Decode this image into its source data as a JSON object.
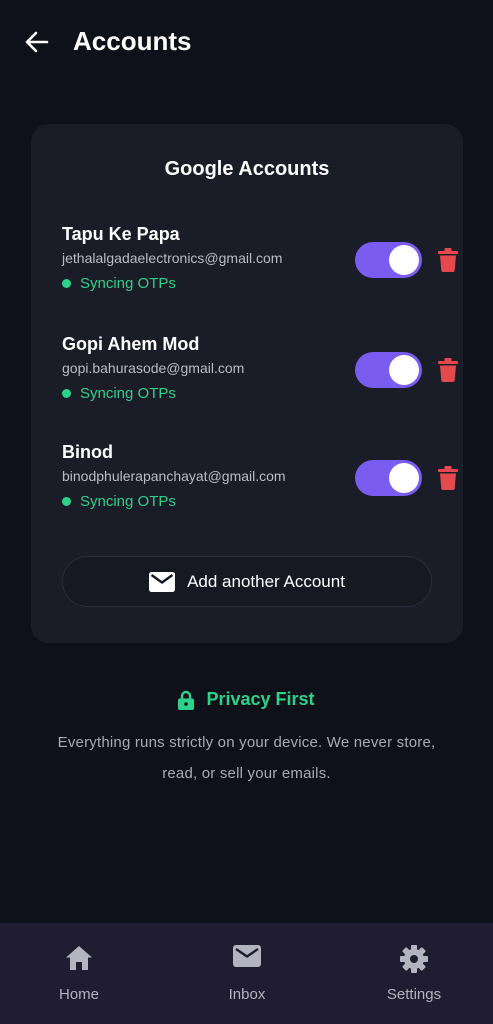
{
  "header": {
    "title": "Accounts",
    "back_icon": "arrow-left-icon"
  },
  "card": {
    "title": "Google Accounts",
    "accounts": [
      {
        "name": "Tapu Ke Papa",
        "email": "jethalalgadaelectronics@gmail.com",
        "status": "Syncing OTPs",
        "sync_enabled": true
      },
      {
        "name": "Gopi Ahem Mod",
        "email": "gopi.bahurasode@gmail.com",
        "status": "Syncing OTPs",
        "sync_enabled": true
      },
      {
        "name": "Binod",
        "email": "binodphulerapanchayat@gmail.com",
        "status": "Syncing OTPs",
        "sync_enabled": true
      }
    ],
    "add_button_label": "Add another Account"
  },
  "privacy": {
    "title": "Privacy First",
    "text": "Everything runs strictly on your device. We never store, read, or sell your emails."
  },
  "nav": {
    "items": [
      {
        "label": "Home",
        "icon": "home-icon"
      },
      {
        "label": "Inbox",
        "icon": "mail-icon"
      },
      {
        "label": "Settings",
        "icon": "gear-icon"
      }
    ]
  },
  "colors": {
    "background": "#0f111a",
    "card": "#1a1c27",
    "accent": "#7b5cf0",
    "success": "#2ed18a",
    "danger": "#e5484d",
    "nav_background": "#201c32"
  }
}
